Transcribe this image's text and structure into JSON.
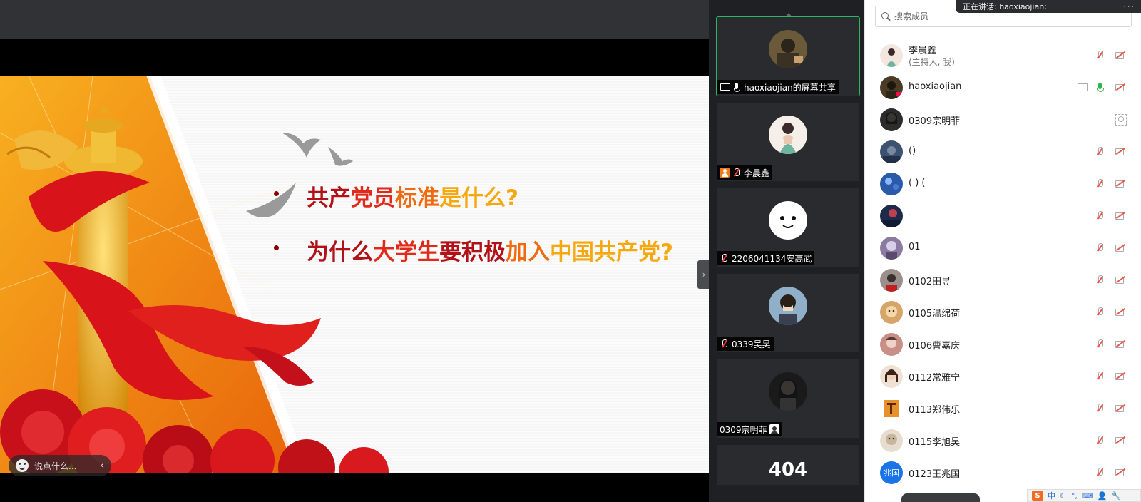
{
  "slide": {
    "bullet1": [
      "共产",
      "党员",
      "标准",
      "是什么?"
    ],
    "bullet2": [
      "为什么",
      "大学生",
      "要积极",
      "加入",
      "中国共产党?"
    ]
  },
  "chat": {
    "placeholder_text": "说点什么...",
    "collapse_glyph": "‹"
  },
  "gallery": {
    "expand_glyph": "›",
    "tiles": [
      {
        "name": "haoxiaojian的屏幕共享",
        "icons": [
          "screen-share-icon",
          "mic-on-icon"
        ]
      },
      {
        "name": "李晨鑫",
        "icons": [
          "host-icon",
          "mic-muted-icon"
        ]
      },
      {
        "name": "2206041134安高武",
        "icons": [
          "mic-muted-icon"
        ]
      },
      {
        "name": "0339吴昊",
        "icons": [
          "mic-muted-icon"
        ]
      },
      {
        "name": "0309宗明菲",
        "icons": [
          "face-icon"
        ]
      },
      {
        "name": "404",
        "icons": []
      }
    ]
  },
  "notice": {
    "text": "正在讲话: haoxiaojian;",
    "dots": "···"
  },
  "search": {
    "placeholder": "搜索成员"
  },
  "members": [
    {
      "name": "李晨鑫",
      "role": "(主持人, 我)",
      "avatar_color": "#f3e6df",
      "icons": [
        "mic-muted",
        "cam-off"
      ]
    },
    {
      "name": "haoxiaojian",
      "role": "",
      "avatar_color": "#4b3a24",
      "icons": [
        "screen-share",
        "mic-on"
      ],
      "extra": "cam-off"
    },
    {
      "name": "0309宗明菲",
      "role": "",
      "avatar_color": "#2c2c2c",
      "icons": [
        "face-detect"
      ]
    },
    {
      "name": "()",
      "role": "",
      "avatar_color": "#3d5270",
      "icons": [
        "mic-muted",
        "cam-off"
      ]
    },
    {
      "name": "( ) (",
      "role": "",
      "avatar_color": "#2a5aa8",
      "icons": [
        "mic-muted",
        "cam-off"
      ]
    },
    {
      "name": "-",
      "role": "",
      "avatar_color": "#1e2a4a",
      "icons": [
        "mic-muted",
        "cam-off"
      ]
    },
    {
      "name": "01",
      "role": "",
      "avatar_color": "#8c7ba0",
      "icons": [
        "mic-muted",
        "cam-off"
      ]
    },
    {
      "name": "0102田昱",
      "role": "",
      "avatar_color": "#9a8f8a",
      "icons": [
        "mic-muted",
        "cam-off"
      ]
    },
    {
      "name": "0105温绵荷",
      "role": "",
      "avatar_color": "#d6a56a",
      "icons": [
        "mic-muted",
        "cam-off"
      ]
    },
    {
      "name": "0106曹嘉庆",
      "role": "",
      "avatar_color": "#c78f86",
      "icons": [
        "mic-muted",
        "cam-off"
      ]
    },
    {
      "name": "0112常雅宁",
      "role": "",
      "avatar_color": "#6a4a3a",
      "icons": [
        "mic-muted",
        "cam-off"
      ]
    },
    {
      "name": "0113郑伟乐",
      "role": "",
      "avatar_color": "#e8902a",
      "icons": [
        "mic-muted",
        "cam-off"
      ]
    },
    {
      "name": "0115李旭昊",
      "role": "",
      "avatar_color": "#c9b59a",
      "icons": [
        "mic-muted",
        "cam-off"
      ]
    },
    {
      "name": "0123王兆国",
      "role": "",
      "avatar_color": "#1a73e8",
      "avatar_text": "兆国",
      "icons": [
        "mic-muted",
        "cam-off"
      ]
    }
  ],
  "ime": {
    "logo": "S",
    "label": "中"
  },
  "colors": {
    "accent_green": "#2fb36a",
    "mute_red": "#e54444",
    "tile_bg": "#2a2b2f"
  }
}
